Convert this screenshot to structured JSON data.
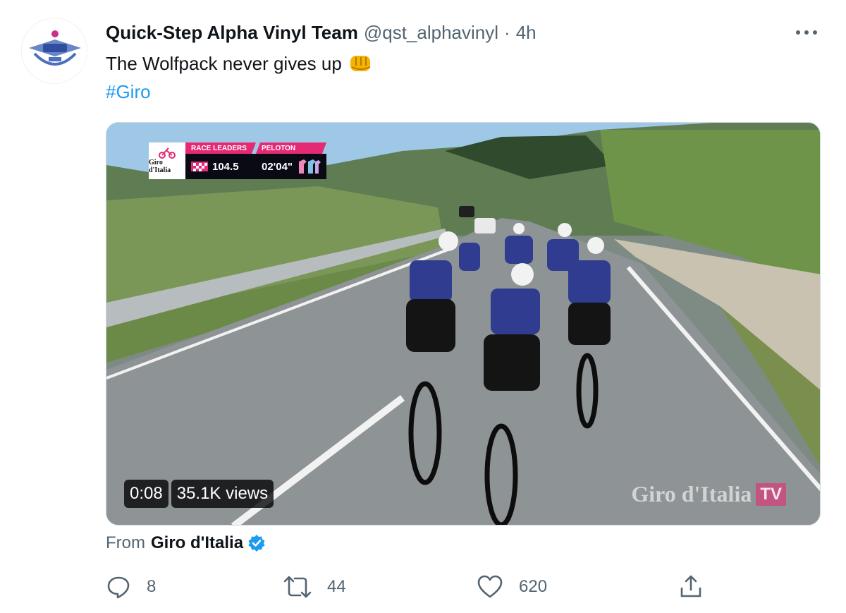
{
  "tweet": {
    "display_name": "Quick-Step Alpha Vinyl Team",
    "handle": "@qst_alphavinyl",
    "separator": "·",
    "time": "4h",
    "text": "The Wolfpack never gives up",
    "hashtag": "#Giro"
  },
  "video": {
    "overlay": {
      "logo_text": "Giro d'Italia",
      "race_leaders_label": "RACE LEADERS",
      "race_leaders_value": "104.5",
      "peloton_label": "PELOTON",
      "peloton_value": "02'04\""
    },
    "time": "0:08",
    "views": "35.1K views",
    "watermark": "Giro d'Italia",
    "watermark_tv": "TV"
  },
  "source": {
    "prefix": "From",
    "name": "Giro d'Italia"
  },
  "actions": {
    "replies": "8",
    "retweets": "44",
    "likes": "620"
  },
  "icons": {
    "more": "more-icon",
    "reply": "reply-icon",
    "retweet": "retweet-icon",
    "like": "heart-icon",
    "share": "share-icon",
    "verified": "verified-badge-icon",
    "fist": "oncoming-fist-emoji"
  },
  "colors": {
    "link": "#1d9bf0",
    "secondary_text": "#536471",
    "giro_pink": "#e52a74"
  }
}
